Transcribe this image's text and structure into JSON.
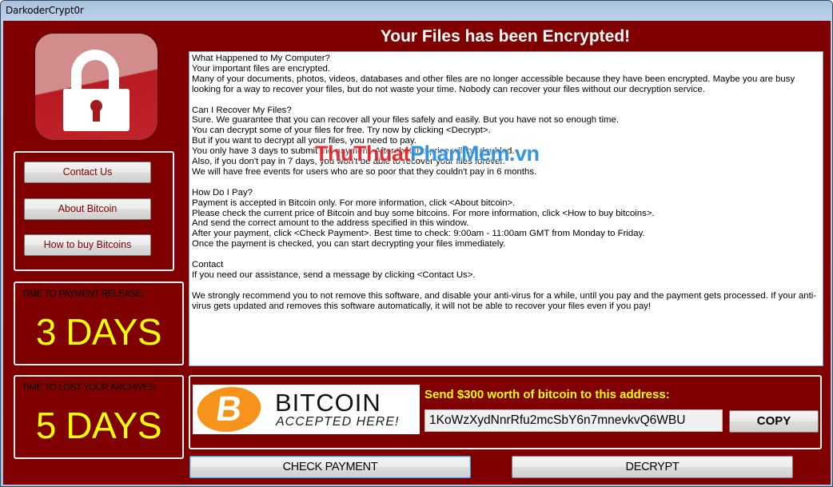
{
  "window": {
    "title": "DarkoderCrypt0r"
  },
  "headline": "Your Files has been Encrypted!",
  "sidebar": {
    "buttons": [
      {
        "label": "Contact Us"
      },
      {
        "label": "About Bitcoin"
      },
      {
        "label": "How to buy Bitcoins"
      }
    ],
    "timers": [
      {
        "label": "TIME TO PAYMENT RELEASE:",
        "value": "3 DAYS"
      },
      {
        "label": "TIME TO LOST YOUR ARCHIVES:",
        "value": "5 DAYS"
      }
    ]
  },
  "message": {
    "lines": [
      "What Happened to My Computer?",
      "Your important files are encrypted.",
      "Many of your documents, photos, videos, databases and other files are no longer accessible because they have been encrypted. Maybe you are busy looking for a way to recover your files, but do not waste your time. Nobody can recover your files without our decryption service.",
      "",
      "Can I Recover My Files?",
      "Sure. We guarantee that you can recover all your files safely and easily. But you have not so enough time.",
      "You can decrypt some of your files for free. Try now by clicking <Decrypt>.",
      "But if you want to decrypt all your files, you need to pay.",
      "You only have 3 days to submit the payment. After that the price will be doubled.",
      "Also, if you don't pay in 7 days, you won't be able to recover your files forever.",
      "We will have free events for users who are so poor that they couldn't pay in 6 months.",
      "",
      "How Do I Pay?",
      "Payment is accepted in Bitcoin only. For more information, click <About bitcoin>.",
      "Please check the current price of Bitcoin and buy some bitcoins. For more information, click <How to buy bitcoins>.",
      "And send the correct amount to the address specified in this window.",
      "After your payment, click <Check Payment>. Best time to check: 9:00am - 11:00am GMT from Monday to Friday.",
      "Once the payment is checked, you can start decrypting your files immediately.",
      "",
      "Contact",
      "If you need our assistance, send a message by clicking <Contact Us>.",
      "",
      "We strongly recommend you to not remove this software, and disable your anti-virus for a while, until you pay and the payment gets processed. If your anti-virus gets updated and removes this software automatically, it will not be able to recover your files even if you pay!"
    ]
  },
  "watermark": {
    "part1": "ThuThuat",
    "part2": "PhanMem.vn"
  },
  "payment": {
    "banner_symbol": "B",
    "banner_title": "BITCOIN",
    "banner_subtitle": "ACCEPTED HERE!",
    "send_label": "Send $300 worth of bitcoin to this address:",
    "address": "1KoWzXydNnrRfu2mcSbY6n7mnevkvQ6WBU",
    "copy_label": "COPY"
  },
  "actions": {
    "check_payment_label": "CHECK PAYMENT",
    "decrypt_label": "DECRYPT"
  },
  "colors": {
    "background": "#800000",
    "accent_text": "#ffff00",
    "bitcoin_orange": "#f7931a"
  }
}
